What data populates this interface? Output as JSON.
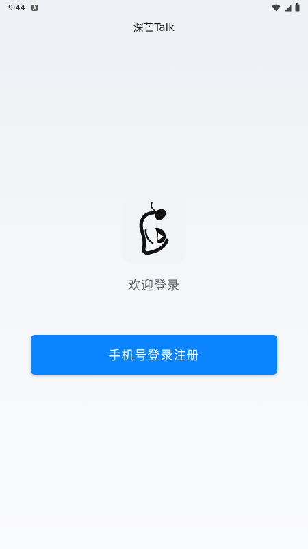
{
  "status_bar": {
    "time": "9:44",
    "notification_icon": "a-box-icon",
    "icons": [
      "wifi-icon",
      "signal-icon",
      "battery-icon"
    ]
  },
  "app_bar": {
    "title": "深芒Talk"
  },
  "main": {
    "logo_icon": "mango-logo-icon",
    "welcome_text": "欢迎登录",
    "login_button_label": "手机号登录注册"
  },
  "colors": {
    "primary": "#0a84ff",
    "background": "#f3f5f8",
    "welcome_text": "#5f6368"
  }
}
